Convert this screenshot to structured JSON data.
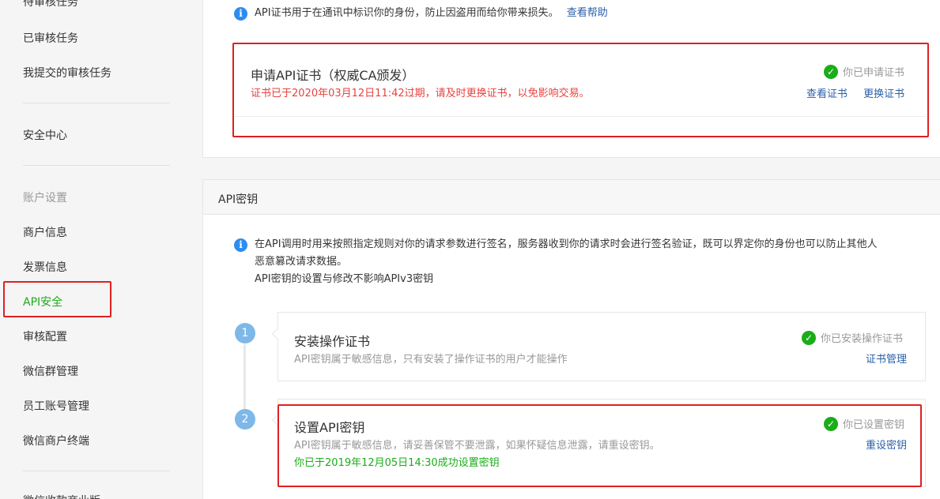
{
  "sidebar": {
    "items": [
      {
        "label": "待审核任务",
        "state": "normal"
      },
      {
        "label": "已审核任务",
        "state": "normal"
      },
      {
        "label": "我提交的审核任务",
        "state": "normal"
      },
      {
        "label": "安全中心",
        "state": "normal"
      },
      {
        "label": "账户设置",
        "state": "muted"
      },
      {
        "label": "商户信息",
        "state": "normal"
      },
      {
        "label": "发票信息",
        "state": "normal"
      },
      {
        "label": "API安全",
        "state": "active"
      },
      {
        "label": "审核配置",
        "state": "normal"
      },
      {
        "label": "微信群管理",
        "state": "normal"
      },
      {
        "label": "员工账号管理",
        "state": "normal"
      },
      {
        "label": "微信商户终端",
        "state": "normal"
      },
      {
        "label": "微信收款商业版",
        "state": "normal"
      }
    ]
  },
  "cert_section": {
    "info_text": "API证书用于在通讯中标识你的身份，防止因盗用而给你带来损失。",
    "help_link": "查看帮助",
    "card": {
      "title": "申请API证书（权威CA颁发）",
      "warning": "证书已于2020年03月12日11:42过期，请及时更换证书，以免影响交易。",
      "status": "你已申请证书",
      "action_view": "查看证书",
      "action_replace": "更换证书"
    }
  },
  "api_key_section": {
    "header": "API密钥",
    "info_line1": "在API调用时用来按照指定规则对你的请求参数进行签名，服务器收到你的请求时会进行签名验证，既可以界定你的身份也可以防止其他人",
    "info_line2": "恶意篡改请求数据。",
    "info_line3": "API密钥的设置与修改不影响APIv3密钥",
    "steps": [
      {
        "number": "1",
        "title": "安装操作证书",
        "desc": "API密钥属于敏感信息，只有安装了操作证书的用户才能操作",
        "status": "你已安装操作证书",
        "action": "证书管理"
      },
      {
        "number": "2",
        "title": "设置API密钥",
        "desc": "API密钥属于敏感信息，请妥善保管不要泄露，如果怀疑信息泄露，请重设密钥。",
        "success": "你已于2019年12月05日14:30成功设置密钥",
        "status": "你已设置密钥",
        "action": "重设密钥"
      }
    ]
  },
  "icons": {
    "info": "info-circle-icon",
    "check": "check-circle-icon"
  },
  "colors": {
    "accent_green": "#1aad19",
    "link_blue": "#2a5fa8",
    "warning_red": "#e64340",
    "info_blue": "#2d8cf0",
    "highlight_red": "#e02020",
    "step_blue": "#7db8e8"
  }
}
